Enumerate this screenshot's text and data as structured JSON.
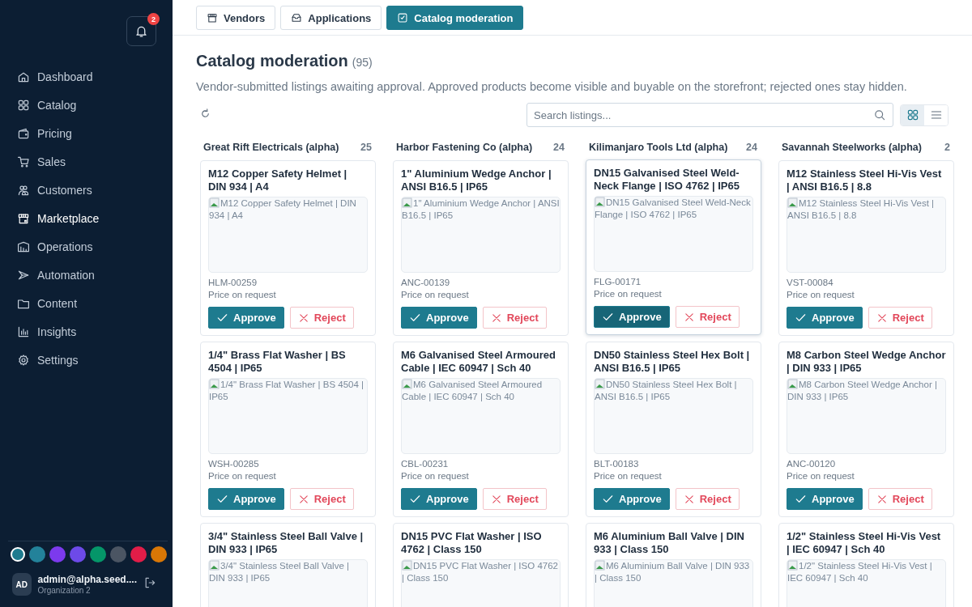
{
  "sidebar": {
    "notifications": {
      "count": "2"
    },
    "items": [
      {
        "label": "Dashboard",
        "selected": false
      },
      {
        "label": "Catalog",
        "selected": false
      },
      {
        "label": "Pricing",
        "selected": false
      },
      {
        "label": "Sales",
        "selected": false
      },
      {
        "label": "Customers",
        "selected": false
      },
      {
        "label": "Marketplace",
        "selected": true
      },
      {
        "label": "Operations",
        "selected": false
      },
      {
        "label": "Automation",
        "selected": false
      },
      {
        "label": "Content",
        "selected": false
      },
      {
        "label": "Insights",
        "selected": false
      },
      {
        "label": "Settings",
        "selected": false
      }
    ],
    "theme_swatches": [
      {
        "color": "#1e7b8f",
        "selected": true
      },
      {
        "color": "#23829a",
        "selected": false
      },
      {
        "color": "#7c3aed",
        "selected": false
      },
      {
        "color": "#6d4ae8",
        "selected": false
      },
      {
        "color": "#059669",
        "selected": false
      },
      {
        "color": "#4b5563",
        "selected": false
      },
      {
        "color": "#e11d48",
        "selected": false
      },
      {
        "color": "#d97706",
        "selected": false
      }
    ],
    "user": {
      "initials": "AD",
      "email": "admin@alpha.seed....",
      "organization": "Organization 2"
    }
  },
  "tabs": [
    {
      "label": "Vendors",
      "selected": false
    },
    {
      "label": "Applications",
      "selected": false
    },
    {
      "label": "Catalog moderation",
      "selected": true
    }
  ],
  "page": {
    "title": "Catalog moderation",
    "count": "(95)",
    "description": "Vendor-submitted listings awaiting approval. Approved products become visible and buyable on the storefront; rejected ones stay hidden."
  },
  "search": {
    "placeholder": "Search listings..."
  },
  "view_toggle": [
    {
      "kind": "grid",
      "selected": true
    },
    {
      "kind": "list",
      "selected": false
    }
  ],
  "columns": [
    {
      "vendor": "Great Rift Electricals (alpha)",
      "count": "25",
      "cards": [
        {
          "title": "M12 Copper Safety Helmet | DIN 934 | A4",
          "image_alt": "M12 Copper Safety Helmet | DIN 934 | A4",
          "sku": "HLM-00259",
          "price": "Price on request",
          "approve": "Approve",
          "reject": "Reject",
          "highlighted": false
        },
        {
          "title": "1/4\" Brass Flat Washer | BS 4504 | IP65",
          "image_alt": "1/4\" Brass Flat Washer | BS 4504 | IP65",
          "sku": "WSH-00285",
          "price": "Price on request",
          "approve": "Approve",
          "reject": "Reject",
          "highlighted": false
        },
        {
          "title": "3/4\" Stainless Steel Ball Valve | DIN 933 | IP65",
          "image_alt": "3/4\" Stainless Steel Ball Valve | DIN 933 | IP65",
          "highlighted": false
        }
      ]
    },
    {
      "vendor": "Harbor Fastening Co (alpha)",
      "count": "24",
      "cards": [
        {
          "title": "1\" Aluminium Wedge Anchor | ANSI B16.5 | IP65",
          "image_alt": "1\" Aluminium Wedge Anchor | ANSI B16.5 | IP65",
          "sku": "ANC-00139",
          "price": "Price on request",
          "approve": "Approve",
          "reject": "Reject",
          "highlighted": false
        },
        {
          "title": "M6 Galvanised Steel Armoured Cable | IEC 60947 | Sch 40",
          "image_alt": "M6 Galvanised Steel Armoured Cable | IEC 60947 | Sch 40",
          "sku": "CBL-00231",
          "price": "Price on request",
          "approve": "Approve",
          "reject": "Reject",
          "highlighted": false
        },
        {
          "title": "DN15 PVC Flat Washer | ISO 4762 | Class 150",
          "image_alt": "DN15 PVC Flat Washer | ISO 4762 | Class 150",
          "highlighted": false
        }
      ]
    },
    {
      "vendor": "Kilimanjaro Tools Ltd (alpha)",
      "count": "24",
      "cards": [
        {
          "title": "DN15 Galvanised Steel Weld-Neck Flange | ISO 4762 | IP65",
          "image_alt": "DN15 Galvanised Steel Weld-Neck Flange | ISO 4762 | IP65",
          "sku": "FLG-00171",
          "price": "Price on request",
          "approve": "Approve",
          "reject": "Reject",
          "highlighted": true
        },
        {
          "title": "DN50 Stainless Steel Hex Bolt | ANSI B16.5 | IP65",
          "image_alt": "DN50 Stainless Steel Hex Bolt | ANSI B16.5 | IP65",
          "sku": "BLT-00183",
          "price": "Price on request",
          "approve": "Approve",
          "reject": "Reject",
          "highlighted": false
        },
        {
          "title": "M6 Aluminium Ball Valve | DIN 933 | Class 150",
          "image_alt": "M6 Aluminium Ball Valve | DIN 933 | Class 150",
          "highlighted": false
        }
      ]
    },
    {
      "vendor": "Savannah Steelworks (alpha)",
      "count": "2",
      "cards": [
        {
          "title": "M12 Stainless Steel Hi-Vis Vest | ANSI B16.5 | 8.8",
          "image_alt": "M12 Stainless Steel Hi-Vis Vest | ANSI B16.5 | 8.8",
          "sku": "VST-00084",
          "price": "Price on request",
          "approve": "Approve",
          "reject": "Reject",
          "highlighted": false
        },
        {
          "title": "M8 Carbon Steel Wedge Anchor | DIN 933 | IP65",
          "image_alt": "M8 Carbon Steel Wedge Anchor | DIN 933 | IP65",
          "sku": "ANC-00120",
          "price": "Price on request",
          "approve": "Approve",
          "reject": "Reject",
          "highlighted": false
        },
        {
          "title": "1/2\" Stainless Steel Hi-Vis Vest | IEC 60947 | Sch 40",
          "image_alt": "1/2\" Stainless Steel Hi-Vis Vest | IEC 60947 | Sch 40",
          "highlighted": false
        }
      ]
    }
  ]
}
